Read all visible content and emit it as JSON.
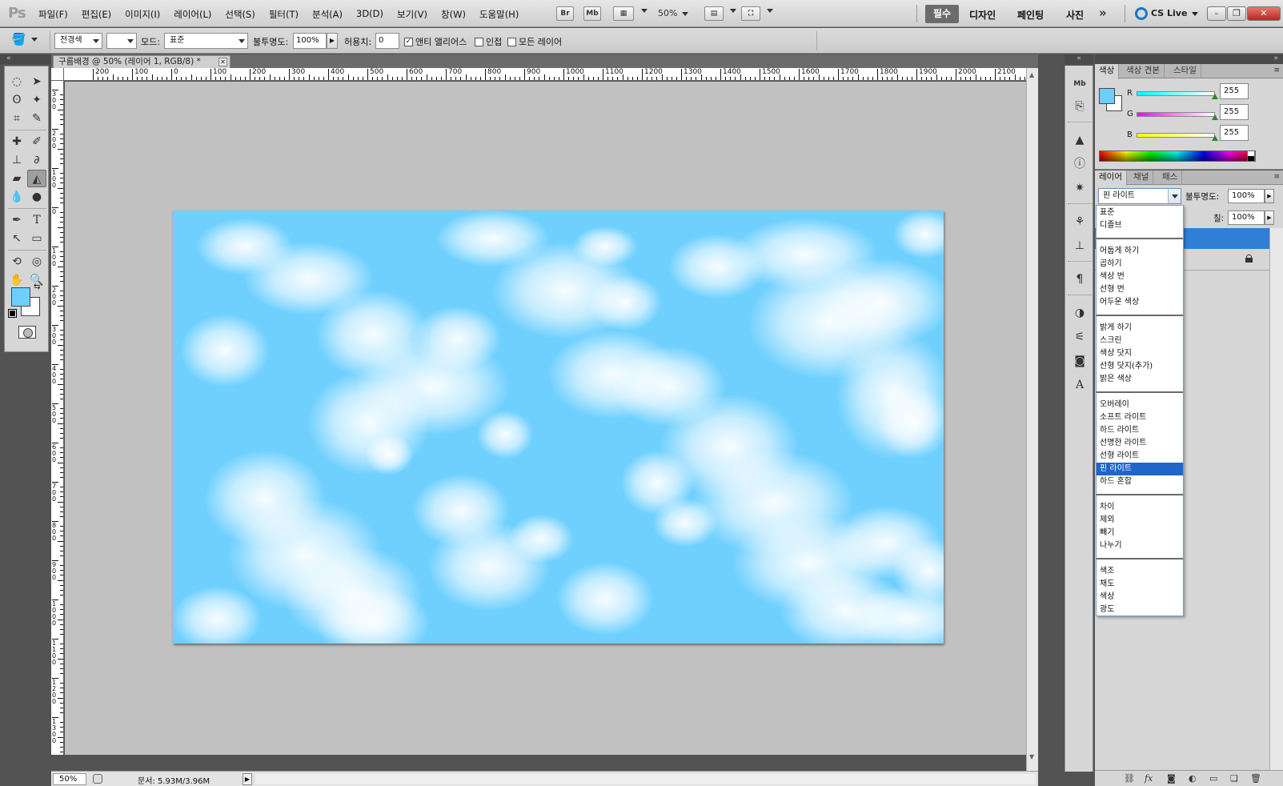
{
  "app": {
    "logo": "Ps"
  },
  "menu": [
    "파일(F)",
    "편집(E)",
    "이미지(I)",
    "레이어(L)",
    "선택(S)",
    "필터(T)",
    "분석(A)",
    "3D(D)",
    "보기(V)",
    "창(W)",
    "도움말(H)"
  ],
  "appbar": {
    "bridge": "Br",
    "mini_bridge": "Mb",
    "zoom": "50%"
  },
  "workspaces": {
    "active": "필수",
    "items": [
      "디자인",
      "페인팅",
      "사진"
    ],
    "more": "»",
    "cs_live": "CS Live"
  },
  "options": {
    "preset": "전경색",
    "mode_label": "모드:",
    "mode_value": "표준",
    "opacity_label": "불투명도:",
    "opacity_value": "100%",
    "tolerance_label": "허용치:",
    "tolerance_value": "0",
    "antialias_label": "앤티 앨리어스",
    "contiguous_label": "인접",
    "all_layers_label": "모든 레이어"
  },
  "document": {
    "tab_title": "구름배경 @ 50% (레이어 1, RGB/8) *",
    "ruler_h": [
      "200",
      "100",
      "0",
      "100",
      "200",
      "300",
      "400",
      "500",
      "600",
      "700",
      "800",
      "900",
      "1000",
      "1100",
      "1200",
      "1300",
      "1400",
      "1500",
      "1600",
      "1700",
      "1800",
      "1900",
      "2000",
      "2100"
    ],
    "ruler_v": [
      "300",
      "200",
      "100",
      "0",
      "100",
      "200",
      "300",
      "400",
      "500",
      "600",
      "700",
      "800",
      "900",
      "1000",
      "1100",
      "1200",
      "1300"
    ],
    "canvas_color": "#6fd0fe"
  },
  "status": {
    "zoom": "50%",
    "doc_info": "문서: 5.93M/3.96M"
  },
  "colors": {
    "foreground": "#6dcfff",
    "background": "#ffffff"
  },
  "color_panel": {
    "tabs": [
      "색상",
      "색상 견본",
      "스타일"
    ],
    "channels": [
      {
        "label": "R",
        "value": "255"
      },
      {
        "label": "G",
        "value": "255"
      },
      {
        "label": "B",
        "value": "255"
      }
    ]
  },
  "layers_panel": {
    "tabs": [
      "레이어",
      "채널",
      "패스"
    ],
    "blend_mode": "핀 라이트",
    "opacity_label": "불투명도:",
    "opacity_value": "100%",
    "fill_label": "칠:",
    "fill_value": "100%"
  },
  "blend_modes": {
    "groups": [
      [
        "표준",
        "디졸브"
      ],
      [
        "어둡게 하기",
        "곱하기",
        "색상 번",
        "선형 번",
        "어두운 색상"
      ],
      [
        "밝게 하기",
        "스크린",
        "색상 닷지",
        "선형 닷지(추가)",
        "밝은 색상"
      ],
      [
        "오버레이",
        "소프트 라이트",
        "하드 라이트",
        "선명한 라이트",
        "선형 라이트",
        "핀 라이트",
        "하드 혼합"
      ],
      [
        "차이",
        "제외",
        "빼기",
        "나누기"
      ],
      [
        "색조",
        "채도",
        "색상",
        "광도"
      ]
    ],
    "selected": "핀 라이트"
  }
}
